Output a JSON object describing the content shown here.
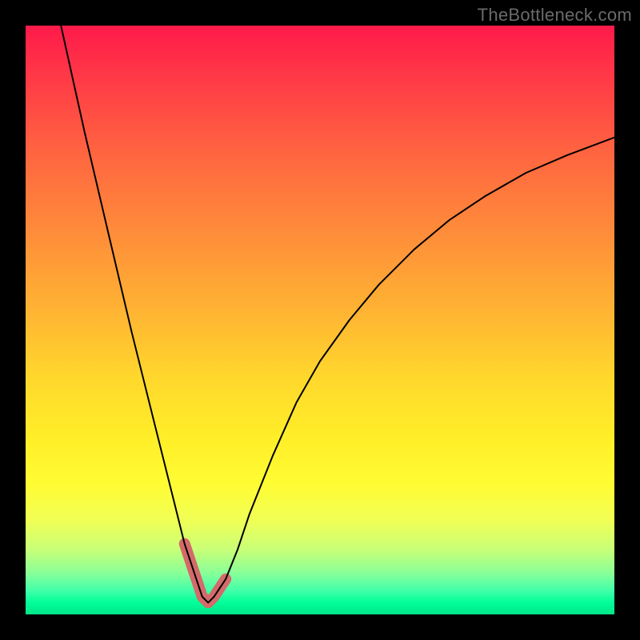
{
  "watermark": "TheBottleneck.com",
  "chart_data": {
    "type": "line",
    "title": "",
    "xlabel": "",
    "ylabel": "",
    "xlim": [
      0,
      100
    ],
    "ylim": [
      0,
      100
    ],
    "grid": false,
    "legend": false,
    "series": [
      {
        "name": "bottleneck-curve",
        "x": [
          6,
          10,
          14,
          18,
          22,
          25,
          27,
          29,
          30,
          31,
          32,
          34,
          36,
          38,
          42,
          46,
          50,
          55,
          60,
          66,
          72,
          78,
          85,
          92,
          100
        ],
        "y": [
          100,
          82,
          65,
          48,
          32,
          20,
          12,
          6,
          3,
          2,
          3,
          6,
          11,
          17,
          27,
          36,
          43,
          50,
          56,
          62,
          67,
          71,
          75,
          78,
          81
        ]
      }
    ],
    "annotations": [
      {
        "name": "minimum-highlight",
        "x": [
          27,
          29,
          30,
          31,
          32,
          34
        ],
        "y": [
          12,
          6,
          3,
          2,
          3,
          6
        ]
      }
    ]
  }
}
